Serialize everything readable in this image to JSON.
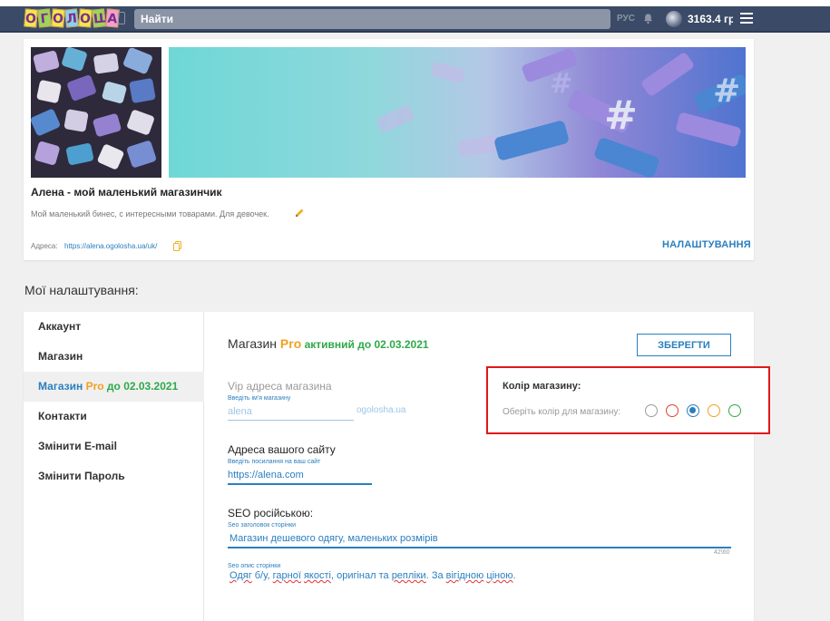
{
  "header": {
    "logo_letters": [
      "О",
      "Г",
      "О",
      "Л",
      "О",
      "Ш",
      "А"
    ],
    "search_placeholder": "Найти",
    "lang": "РУС",
    "balance": "3163.4 грн"
  },
  "shop": {
    "title": "Алена - мой маленький магазинчик",
    "description": "Мой маленький бинес, с интересными товарами. Для девочек.",
    "address_label": "Адреса:",
    "address_link": "https://alena.ogolosha.ua/uk/",
    "settings_link": "НАЛАШТУВАННЯ"
  },
  "section_title": "Мої налаштування:",
  "sidebar": {
    "items": [
      {
        "label": "Аккаунт"
      },
      {
        "label": "Магазин"
      },
      {
        "label_a": "Магазин ",
        "label_pro": "Pro",
        "label_b": " до 02.03.2021"
      },
      {
        "label": "Контакти"
      },
      {
        "label": "Змінити E-mail"
      },
      {
        "label": "Змінити Пароль"
      }
    ]
  },
  "main": {
    "title_a": "Магазин ",
    "title_pro": "Pro",
    "title_active": " активний до 02.03.2021",
    "save_label": "ЗБЕРЕГТИ",
    "vip_label": "Vip адреса магазина",
    "vip_hint": "Введіть ім'я магазину",
    "vip_value": "alena",
    "domain_suffix": "ogolosha.ua",
    "site_label": "Адреса вашого сайту",
    "site_hint": "Введіть посилання на ваш сайт",
    "site_value": "https://alena.com",
    "seo_label": "SEO російською:",
    "seo_title_hint": "Seo заголовок сторінки",
    "seo_title_value": "Магазин дешевого одягу, маленьких розмірів",
    "seo_counter": "42\\60",
    "seo_desc_hint": "Seo опис сторінки",
    "seo_desc_parts": [
      "Одяг",
      " б/у, ",
      "гарної",
      " ",
      "якості",
      ", оригінал та ",
      "репліки",
      ". За ",
      "вігідною",
      " ",
      "ціною",
      "."
    ]
  },
  "color_box": {
    "title": "Колір магазину:",
    "hint": "Оберіть колір для магазину:",
    "colors": [
      "#9a9a9a",
      "#e0402a",
      "#2a7fc0",
      "#f0a020",
      "#2eaa48"
    ],
    "selected": "#2a7fc0"
  }
}
